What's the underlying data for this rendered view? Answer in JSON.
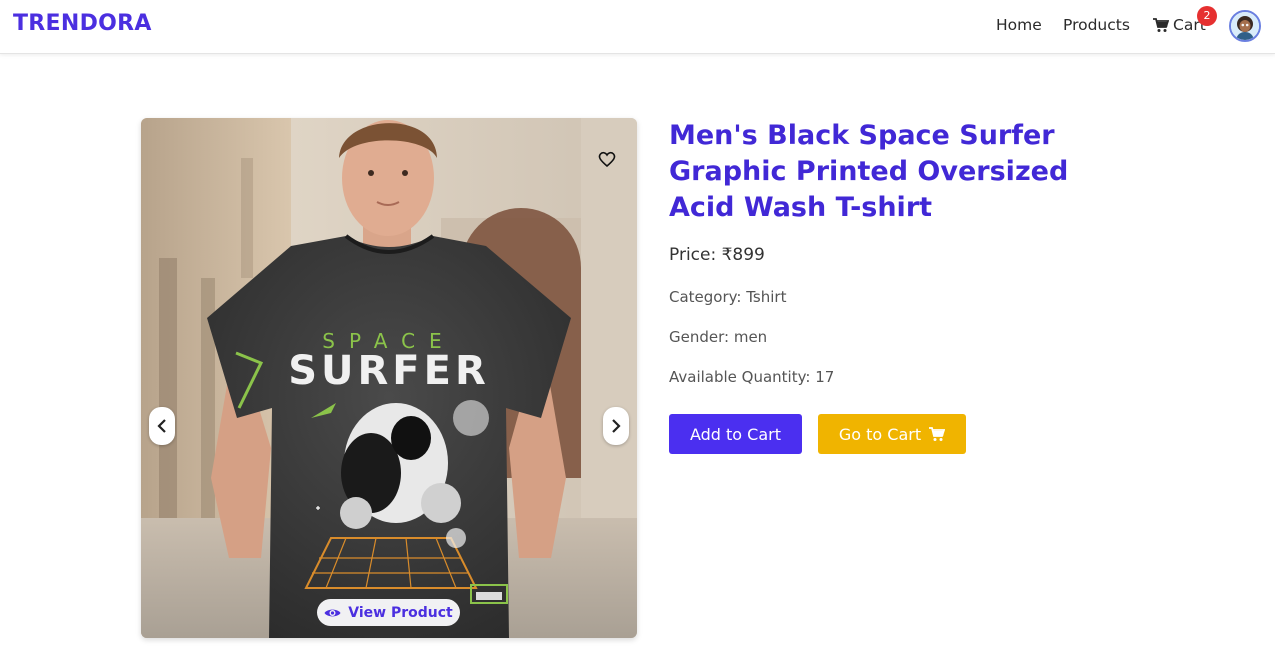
{
  "nav": {
    "brand": "TRENDORA",
    "home": "Home",
    "products": "Products",
    "cart": "Cart",
    "cart_count": "2"
  },
  "product": {
    "title": "Men's Black Space Surfer Graphic Printed Oversized Acid Wash T-shirt",
    "price": "Price: ₹899",
    "category": "Category: Tshirt",
    "gender": "Gender: men",
    "quantity": "Available Quantity: 17",
    "image_alt": "Men's Black Space Surfer Graphic Printed Oversized Acid Wash T-shirt",
    "print_top": "SPACE",
    "print_main": "SURFER"
  },
  "actions": {
    "add_to_cart": "Add to Cart",
    "go_to_cart": "Go to Cart",
    "view_product": "View Product"
  },
  "colors": {
    "brand": "#4b2fe0",
    "title": "#4128d6",
    "add_button": "#4b2ff0",
    "go_button": "#f0b400",
    "badge": "#e63030"
  },
  "icons": {
    "cart": "cart-icon",
    "wishlist": "heart-icon",
    "prev": "chevron-left-icon",
    "next": "chevron-right-icon",
    "view": "eye-icon",
    "avatar": "user-avatar"
  }
}
